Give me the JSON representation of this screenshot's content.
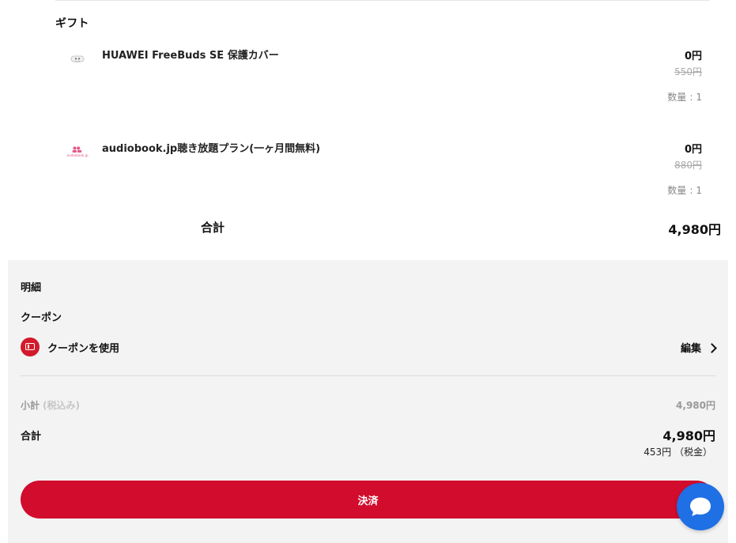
{
  "gift_section": {
    "title": "ギフト",
    "items": [
      {
        "name": "HUAWEI FreeBuds SE 保護カバー",
        "price": "0円",
        "original_price": "550円",
        "quantity_label": "数量",
        "quantity_colon": ":",
        "quantity_value": "1",
        "icon": "earbuds-cover-thumbnail"
      },
      {
        "name": "audiobook.jp聴き放題プラン(一ヶ月間無料)",
        "price": "0円",
        "original_price": "880円",
        "quantity_label": "数量",
        "quantity_colon": ":",
        "quantity_value": "1",
        "logo_text": "audiobook.jp",
        "icon": "audiobook-logo"
      }
    ]
  },
  "cart_total": {
    "label": "合計",
    "value": "4,980円"
  },
  "summary": {
    "details_title": "明細",
    "coupon_title": "クーポン",
    "coupon_label": "クーポンを使用",
    "coupon_edit": "編集",
    "subtotal_label": "小計",
    "subtotal_note": "(税込み)",
    "subtotal_value": "4,980円",
    "total_label": "合計",
    "total_value": "4,980円",
    "tax_value": "453円 （税金）",
    "checkout_label": "決済"
  },
  "colors": {
    "accent_red": "#d10c2d",
    "chat_blue": "#1f6fe5",
    "panel_bg": "#f3f3f3"
  },
  "icons": {
    "coupon": "ticket-icon",
    "edit": "chevron-right-icon",
    "chat": "chat-bubble-icon"
  }
}
